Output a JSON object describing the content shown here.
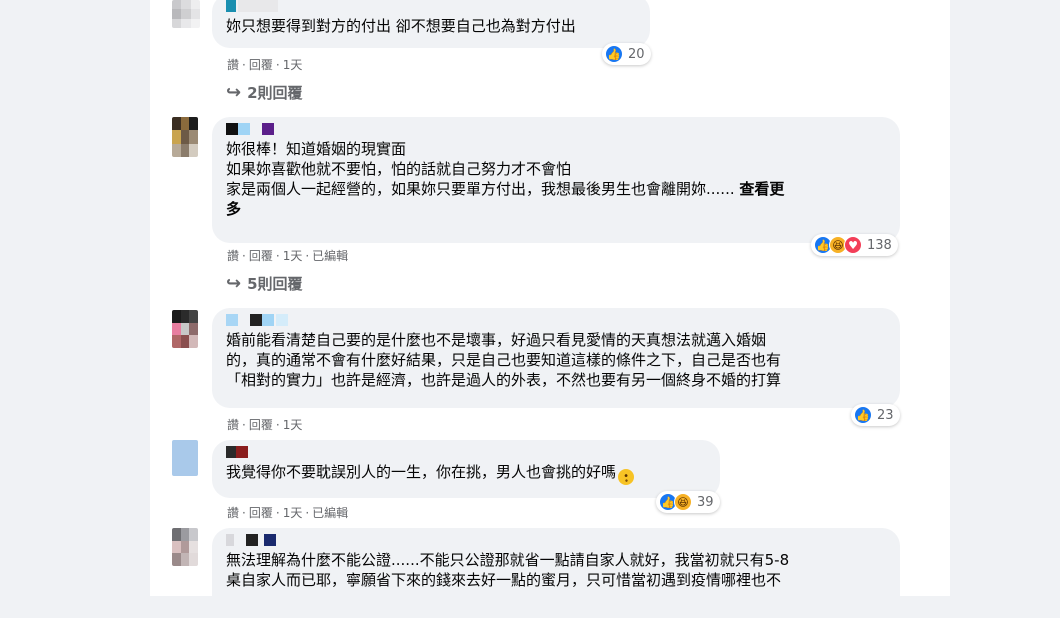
{
  "colors": {
    "background": "#f0f2f5",
    "panel": "#ffffff",
    "bubble": "#f0f2f5",
    "meta_text": "#65676b",
    "like_blue": "#1877f2",
    "haha_yellow": "#f7b125",
    "love_red": "#f33e58"
  },
  "comments": [
    {
      "lines": [
        "妳只想要得到對方的付出 卻不想要自己也為對方付出"
      ],
      "actions": [
        "讚",
        "回覆",
        "1天"
      ],
      "reactions": {
        "icons": [
          "like-icon"
        ],
        "count": "20"
      },
      "replies": "2則回覆"
    },
    {
      "lines": [
        "妳很棒！知道婚姻的現實面",
        "如果妳喜歡他就不要怕，怕的話就自己努力才不會怕",
        "家是兩個人一起經營的，如果妳只要單方付出，我想最後男生也會離開妳......"
      ],
      "see_more_a": "查看更",
      "see_more_b": "多",
      "actions": [
        "讚",
        "回覆",
        "1天",
        "已編輯"
      ],
      "reactions": {
        "icons": [
          "like-icon",
          "haha-icon",
          "love-icon"
        ],
        "count": "138"
      },
      "replies": "5則回覆"
    },
    {
      "lines": [
        "婚前能看清楚自己要的是什麼也不是壞事，好過只看見愛情的天真想法就邁入婚姻",
        "的，真的通常不會有什麼好結果，只是自己也要知道這樣的條件之下，自己是否也有",
        "「相對的實力」也許是經濟，也許是過人的外表，不然也要有另一個終身不婚的打算"
      ],
      "actions": [
        "讚",
        "回覆",
        "1天"
      ],
      "reactions": {
        "icons": [
          "like-icon"
        ],
        "count": "23"
      },
      "replies": ""
    },
    {
      "lines": [
        "我覺得你不要耽誤別人的一生，你在挑，男人也會挑的好嗎"
      ],
      "emoji": "pleading-face-emoji",
      "actions": [
        "讚",
        "回覆",
        "1天",
        "已編輯"
      ],
      "reactions": {
        "icons": [
          "like-icon",
          "haha-icon"
        ],
        "count": "39"
      },
      "replies": ""
    },
    {
      "lines": [
        "無法理解為什麼不能公證......不能只公證那就省一點請自家人就好，我當初就只有5-8",
        "桌自家人而已耶，寧願省下來的錢來去好一點的蜜月，只可惜當初遇到疫情哪裡也不"
      ],
      "actions": [],
      "reactions": null,
      "replies": ""
    }
  ]
}
